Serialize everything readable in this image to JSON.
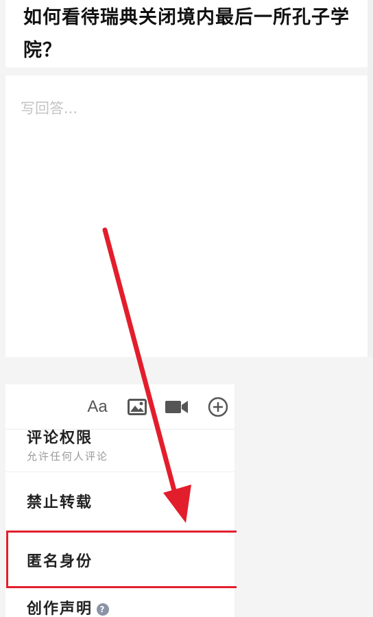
{
  "question": {
    "title": "如何看待瑞典关闭境内最后一所孔子学院？"
  },
  "editor": {
    "placeholder": "写回答..."
  },
  "toolbar": {
    "text_format_label": "Aa",
    "icons": [
      "text-format-icon",
      "image-icon",
      "video-icon",
      "add-icon"
    ]
  },
  "options": {
    "comment_permission": {
      "label": "评论权限",
      "sub": "允许任何人评论"
    },
    "no_repost": {
      "label": "禁止转载"
    },
    "anonymous": {
      "label": "匿名身份"
    },
    "creation_statement": {
      "label": "创作声明",
      "help": "?"
    }
  },
  "colors": {
    "annotation_red": "#e31e2c"
  }
}
